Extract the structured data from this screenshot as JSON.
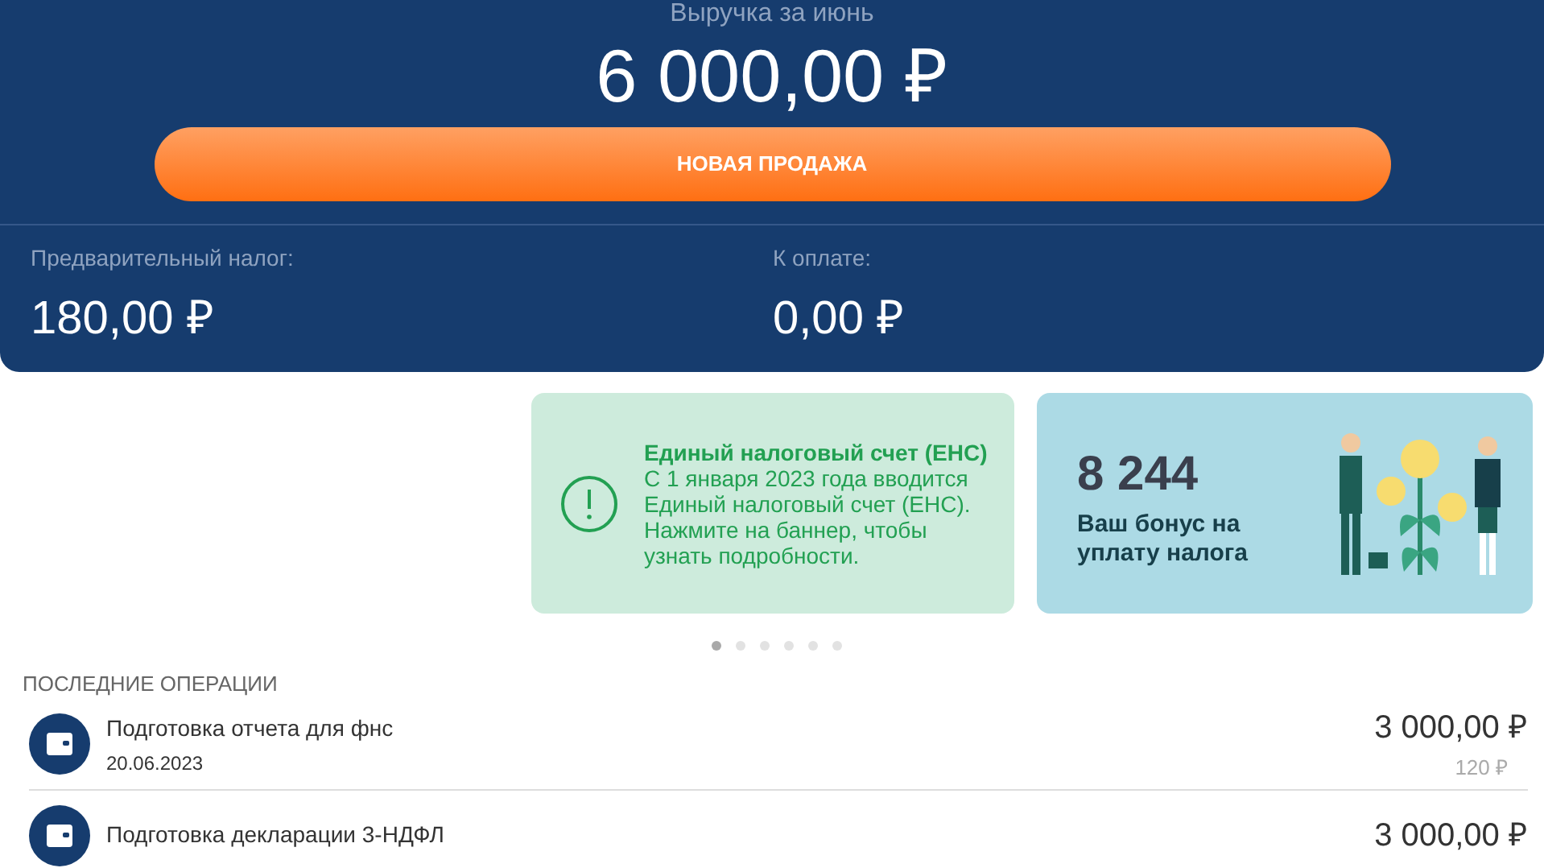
{
  "header": {
    "caption": "Выручка за июнь",
    "amount": "6 000,00 ₽",
    "button": "НОВАЯ ПРОДАЖА",
    "stats": [
      {
        "label": "Предварительный налог:",
        "value": "180,00 ₽"
      },
      {
        "label": "К оплате:",
        "value": "0,00 ₽"
      }
    ]
  },
  "banners": [
    {
      "kind": "info",
      "title": "Единый налоговый счет (ЕНС)",
      "text": " С 1 января 2023 года вводится Единый налоговый счет (ЕНС). Нажмите на баннер, чтобы узнать подробности."
    },
    {
      "kind": "bonus",
      "number": "8 244",
      "text": "Ваш бонус на уплату налога"
    }
  ],
  "pager": [
    {
      "selected": true
    },
    {
      "selected": false
    },
    {
      "selected": false
    },
    {
      "selected": false
    },
    {
      "selected": false
    },
    {
      "selected": false
    }
  ],
  "operations": {
    "title": "ПОСЛЕДНИЕ ОПЕРАЦИИ",
    "items": [
      {
        "name": "Подготовка отчета для фнс",
        "date": "20.06.2023",
        "amount": "3 000,00 ₽",
        "fee": "120 ₽"
      },
      {
        "name": "Подготовка декларации 3-НДФЛ",
        "amount": "3 000,00 ₽"
      }
    ]
  }
}
